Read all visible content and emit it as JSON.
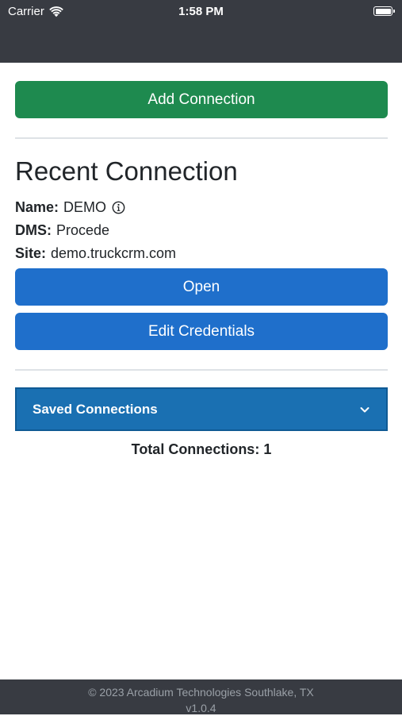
{
  "status_bar": {
    "carrier": "Carrier",
    "time": "1:58 PM",
    "icons": [
      "wifi-icon",
      "battery-icon"
    ]
  },
  "actions": {
    "add_connection_label": "Add Connection"
  },
  "recent": {
    "heading": "Recent Connection",
    "name_label": "Name:",
    "name_value": "DEMO",
    "dms_label": "DMS:",
    "dms_value": "Procede",
    "site_label": "Site:",
    "site_value": "demo.truckcrm.com",
    "open_label": "Open",
    "edit_label": "Edit Credentials"
  },
  "saved": {
    "title": "Saved Connections",
    "total_text": "Total Connections: 1"
  },
  "footer": {
    "copyright": "© 2023 Arcadium Technologies Southlake, TX",
    "version": "v1.0.4"
  },
  "colors": {
    "status_bar_bg": "#383b42",
    "success": "#1e8a4f",
    "primary": "#1f6fcb",
    "accordion": "#1a70b2"
  }
}
